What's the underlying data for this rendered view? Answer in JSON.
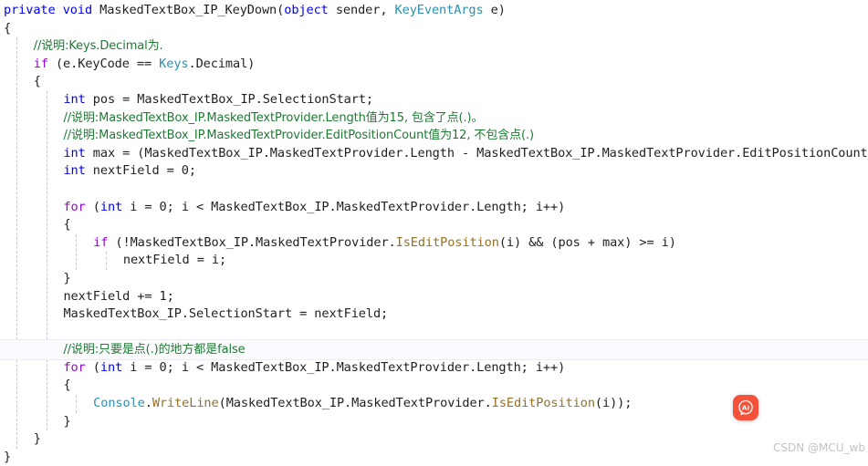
{
  "editor": {
    "language": "csharp",
    "background": "#ffffff",
    "highlight_band_color": "#fbfbfd",
    "indent_guide_color": "#c8c8c8",
    "colors": {
      "keyword": "#0000ff",
      "control": "#8f08c4",
      "type": "#2b91af",
      "method": "#947123",
      "comment": "#1f7a34",
      "plain": "#1f1f1f"
    },
    "lines": [
      {
        "id": 1,
        "indent": 0,
        "highlight": false,
        "tokens": [
          {
            "t": "private",
            "c": "kw"
          },
          {
            "t": " ",
            "c": "pln"
          },
          {
            "t": "void",
            "c": "kw"
          },
          {
            "t": " ",
            "c": "pln"
          },
          {
            "t": "MaskedTextBox_IP_KeyDown",
            "c": "pln"
          },
          {
            "t": "(",
            "c": "pun"
          },
          {
            "t": "object",
            "c": "kw"
          },
          {
            "t": " sender, ",
            "c": "pln"
          },
          {
            "t": "KeyEventArgs",
            "c": "typ"
          },
          {
            "t": " e)",
            "c": "pln"
          }
        ]
      },
      {
        "id": 2,
        "indent": 0,
        "highlight": false,
        "tokens": [
          {
            "t": "{",
            "c": "pun"
          }
        ]
      },
      {
        "id": 3,
        "indent": 1,
        "highlight": false,
        "tokens": [
          {
            "t": "//说明:Keys.Decimal为.",
            "c": "cmt"
          }
        ]
      },
      {
        "id": 4,
        "indent": 1,
        "highlight": false,
        "tokens": [
          {
            "t": "if",
            "c": "ctl"
          },
          {
            "t": " (e.KeyCode == ",
            "c": "pln"
          },
          {
            "t": "Keys",
            "c": "typ"
          },
          {
            "t": ".Decimal)",
            "c": "pln"
          }
        ]
      },
      {
        "id": 5,
        "indent": 1,
        "highlight": false,
        "tokens": [
          {
            "t": "{",
            "c": "pun"
          }
        ]
      },
      {
        "id": 6,
        "indent": 2,
        "highlight": false,
        "tokens": [
          {
            "t": "int",
            "c": "kw"
          },
          {
            "t": " pos = MaskedTextBox_IP.SelectionStart;",
            "c": "pln"
          }
        ]
      },
      {
        "id": 7,
        "indent": 2,
        "highlight": false,
        "tokens": [
          {
            "t": "//说明:MaskedTextBox_IP.MaskedTextProvider.Length值为15, 包含了点(.)。",
            "c": "cmt"
          }
        ]
      },
      {
        "id": 8,
        "indent": 2,
        "highlight": false,
        "tokens": [
          {
            "t": "//说明:MaskedTextBox_IP.MaskedTextProvider.EditPositionCount值为12, 不包含点(.)",
            "c": "cmt"
          }
        ]
      },
      {
        "id": 9,
        "indent": 2,
        "highlight": false,
        "tokens": [
          {
            "t": "int",
            "c": "kw"
          },
          {
            "t": " max = (MaskedTextBox_IP.MaskedTextProvider.Length - MaskedTextBox_IP.MaskedTextProvider.EditPositionCount);",
            "c": "pln"
          }
        ]
      },
      {
        "id": 10,
        "indent": 2,
        "highlight": false,
        "tokens": [
          {
            "t": "int",
            "c": "kw"
          },
          {
            "t": " nextField = 0;",
            "c": "pln"
          }
        ]
      },
      {
        "id": 11,
        "indent": 2,
        "highlight": false,
        "tokens": []
      },
      {
        "id": 12,
        "indent": 2,
        "highlight": false,
        "tokens": [
          {
            "t": "for",
            "c": "ctl"
          },
          {
            "t": " (",
            "c": "pln"
          },
          {
            "t": "int",
            "c": "kw"
          },
          {
            "t": " i = 0; i < MaskedTextBox_IP.MaskedTextProvider.Length; i++)",
            "c": "pln"
          }
        ]
      },
      {
        "id": 13,
        "indent": 2,
        "highlight": false,
        "tokens": [
          {
            "t": "{",
            "c": "pun"
          }
        ]
      },
      {
        "id": 14,
        "indent": 3,
        "highlight": false,
        "tokens": [
          {
            "t": "if",
            "c": "ctl"
          },
          {
            "t": " (!MaskedTextBox_IP.MaskedTextProvider.",
            "c": "pln"
          },
          {
            "t": "IsEditPosition",
            "c": "mth"
          },
          {
            "t": "(i) && (pos + max) >= i)",
            "c": "pln"
          }
        ]
      },
      {
        "id": 15,
        "indent": 4,
        "highlight": false,
        "tokens": [
          {
            "t": "nextField = i;",
            "c": "pln"
          }
        ]
      },
      {
        "id": 16,
        "indent": 2,
        "highlight": false,
        "tokens": [
          {
            "t": "}",
            "c": "pun"
          }
        ]
      },
      {
        "id": 17,
        "indent": 2,
        "highlight": false,
        "tokens": [
          {
            "t": "nextField += 1;",
            "c": "pln"
          }
        ]
      },
      {
        "id": 18,
        "indent": 2,
        "highlight": false,
        "tokens": [
          {
            "t": "MaskedTextBox_IP.SelectionStart = nextField;",
            "c": "pln"
          }
        ]
      },
      {
        "id": 19,
        "indent": 2,
        "highlight": false,
        "tokens": []
      },
      {
        "id": 20,
        "indent": 2,
        "highlight": true,
        "tokens": [
          {
            "t": "//说明:只要是点(.)的地方都是false",
            "c": "cmt"
          }
        ]
      },
      {
        "id": 21,
        "indent": 2,
        "highlight": false,
        "tokens": [
          {
            "t": "for",
            "c": "ctl"
          },
          {
            "t": " (",
            "c": "pln"
          },
          {
            "t": "int",
            "c": "kw"
          },
          {
            "t": " i = 0; i < MaskedTextBox_IP.MaskedTextProvider.Length; i++)",
            "c": "pln"
          }
        ]
      },
      {
        "id": 22,
        "indent": 2,
        "highlight": false,
        "tokens": [
          {
            "t": "{",
            "c": "pun"
          }
        ]
      },
      {
        "id": 23,
        "indent": 3,
        "highlight": false,
        "tokens": [
          {
            "t": "Console",
            "c": "typ"
          },
          {
            "t": ".",
            "c": "pln"
          },
          {
            "t": "WriteLine",
            "c": "mth"
          },
          {
            "t": "(MaskedTextBox_IP.MaskedTextProvider.",
            "c": "pln"
          },
          {
            "t": "IsEditPosition",
            "c": "mth"
          },
          {
            "t": "(i));",
            "c": "pln"
          }
        ]
      },
      {
        "id": 24,
        "indent": 2,
        "highlight": false,
        "tokens": [
          {
            "t": "}",
            "c": "pun"
          }
        ]
      },
      {
        "id": 25,
        "indent": 1,
        "highlight": false,
        "tokens": [
          {
            "t": "}",
            "c": "pun"
          }
        ]
      },
      {
        "id": 26,
        "indent": 0,
        "highlight": false,
        "tokens": [
          {
            "t": "}",
            "c": "pun"
          }
        ]
      }
    ],
    "indent_guides_x": [
      18,
      52,
      86,
      120,
      154
    ]
  },
  "ai_badge": {
    "label": "AI",
    "icon": "ai-assistant-icon",
    "color": "#f4523b"
  },
  "watermark": {
    "text": "CSDN @MCU_wb"
  }
}
